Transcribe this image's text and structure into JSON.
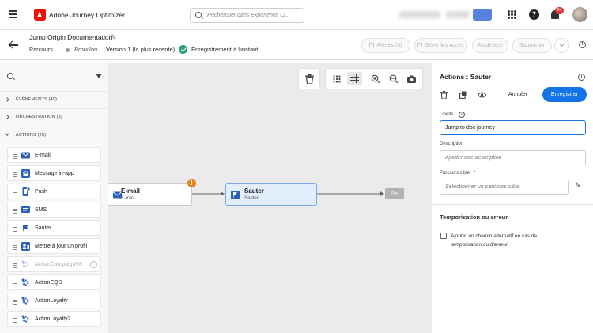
{
  "header": {
    "app_title": "Adobe Journey Optimizer",
    "search_placeholder": "Rechercher dans Experience Cl...",
    "notification_count": "9+"
  },
  "journey": {
    "title": "Jump Origin Documentation",
    "breadcrumb": "Parcours",
    "status": "Brouillon",
    "version": "Version 1 (la plus récente)",
    "save_status": "Enregistrement à l'instant"
  },
  "toolbar": {
    "alerts": "Alertes (6)",
    "manage_access": "Gérer les accès",
    "test_mode": "Mode test",
    "delete": "Supprimer"
  },
  "palette": {
    "sections": [
      {
        "label": "ÉVÉNEMENTS (49)"
      },
      {
        "label": "ORCHESTRATION (3)"
      },
      {
        "label": "ACTIONS (25)"
      }
    ],
    "actions": [
      {
        "label": "E-mail",
        "icon": "email-icon"
      },
      {
        "label": "Message in-app",
        "icon": "in-app-message-icon"
      },
      {
        "label": "Push",
        "icon": "push-icon"
      },
      {
        "label": "SMS",
        "icon": "sms-icon"
      },
      {
        "label": "Sauter",
        "icon": "jump-icon"
      },
      {
        "label": "Mettre à jour un profil",
        "icon": "update-profile-icon"
      },
      {
        "label": "ActionCampaignV8",
        "icon": "custom-action-icon"
      },
      {
        "label": "ActionEQS",
        "icon": "custom-action-icon"
      },
      {
        "label": "ActionLoyalty",
        "icon": "custom-action-icon"
      },
      {
        "label": "ActionLoyalty2",
        "icon": "custom-action-icon"
      }
    ]
  },
  "canvas": {
    "nodes": [
      {
        "title": "E-mail",
        "subtitle": "E-mail"
      },
      {
        "title": "Sauter",
        "subtitle": "Sauter"
      }
    ],
    "end_label": "Fin"
  },
  "properties": {
    "title": "Actions : Sauter",
    "cancel": "Annuler",
    "save": "Enregistrer",
    "label_field": {
      "label": "Libellé",
      "value": "Jump to doc journey"
    },
    "description_field": {
      "label": "Description",
      "placeholder": "Ajouter une description"
    },
    "target_field": {
      "label": "Parcours cible",
      "required": "*",
      "placeholder": "Sélectionner un parcours cible"
    },
    "timeout_section": "Temporisation ou erreur",
    "timeout_checkbox": "Ajouter un chemin alternatif en cas de temporisation ou d'erreur"
  },
  "colors": {
    "accent": "#1473e6",
    "adobe_red": "#eb1000",
    "success": "#2d9d78",
    "warning": "#e68619"
  }
}
